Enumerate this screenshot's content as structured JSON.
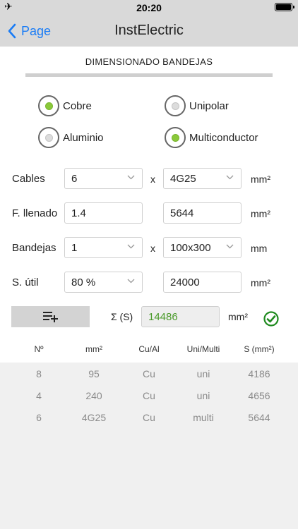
{
  "status_bar": {
    "time": "20:20"
  },
  "nav": {
    "back_label": "Page",
    "title": "InstElectric"
  },
  "section": {
    "title": "DIMENSIONADO BANDEJAS"
  },
  "material": {
    "cobre": {
      "label": "Cobre",
      "selected": true
    },
    "aluminio": {
      "label": "Aluminio",
      "selected": false
    }
  },
  "cable_type": {
    "unipolar": {
      "label": "Unipolar",
      "selected": false
    },
    "multiconductor": {
      "label": "Multiconductor",
      "selected": true
    }
  },
  "form": {
    "multiply_sign": "x",
    "cables": {
      "label": "Cables",
      "count": "6",
      "section": "4G25",
      "unit": "mm²"
    },
    "llenado": {
      "label": "F. llenado",
      "factor": "1.4",
      "value": "5644",
      "unit": "mm²"
    },
    "bandejas": {
      "label": "Bandejas",
      "count": "1",
      "size": "100x300",
      "unit": "mm"
    },
    "util": {
      "label": "S. útil",
      "percent": "80 %",
      "value": "24000",
      "unit": "mm²"
    }
  },
  "sum": {
    "label": "Σ (S)",
    "value": "14486",
    "unit": "mm²",
    "status_color": "#1f8a1f"
  },
  "table": {
    "headers": [
      "Nº",
      "mm²",
      "Cu/Al",
      "Uni/Multi",
      "S (mm²)"
    ],
    "rows": [
      [
        "8",
        "95",
        "Cu",
        "uni",
        "4186"
      ],
      [
        "4",
        "240",
        "Cu",
        "uni",
        "4656"
      ],
      [
        "6",
        "4G25",
        "Cu",
        "multi",
        "5644"
      ]
    ]
  },
  "colors": {
    "accent": "#1a7cf5",
    "radio_on": "#8ac93a",
    "sum_text": "#4a9a2a"
  }
}
